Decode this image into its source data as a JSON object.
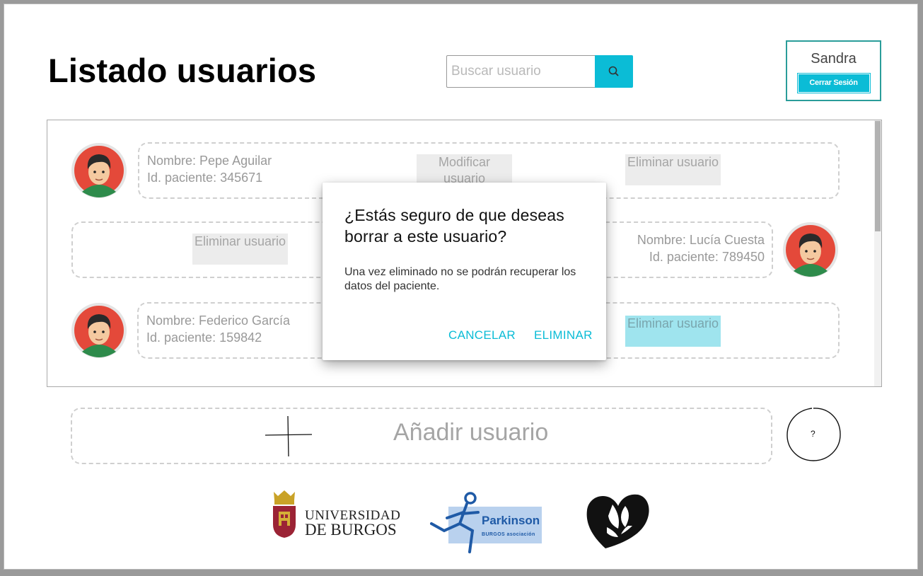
{
  "header": {
    "title": "Listado usuarios",
    "search_placeholder": "Buscar usuario",
    "user_name": "Sandra",
    "logout_label": "Cerrar Sesión"
  },
  "patients": [
    {
      "name": "Nombre: Pepe Aguilar",
      "id": "Id. paciente: 345671",
      "modify_label": "Modificar usuario",
      "delete_label": "Eliminar usuario"
    },
    {
      "name": "Nombre: Lucía Cuesta",
      "id": "Id. paciente: 789450",
      "delete_label": "Eliminar usuario"
    },
    {
      "name": "Nombre: Federico García",
      "id": "Id. paciente: 159842",
      "delete_label": "Eliminar usuario"
    }
  ],
  "add_user": {
    "label": "Añadir usuario"
  },
  "help": {
    "label": "?"
  },
  "modal": {
    "title": "¿Estás seguro de que deseas borrar a este usuario?",
    "body": "Una vez eliminado no se podrán recuperar los datos del paciente.",
    "cancel_label": "CANCELAR",
    "confirm_label": "ELIMINAR"
  },
  "logos": {
    "university_line1": "UNIVERSIDAD",
    "university_line2": "DE BURGOS",
    "parkinson_title": "Parkinson",
    "parkinson_sub": "BURGOS asociación"
  },
  "colors": {
    "accent": "#0bbcd6",
    "user_box_border": "#2a9d9a",
    "avatar_red": "#e4493a"
  }
}
